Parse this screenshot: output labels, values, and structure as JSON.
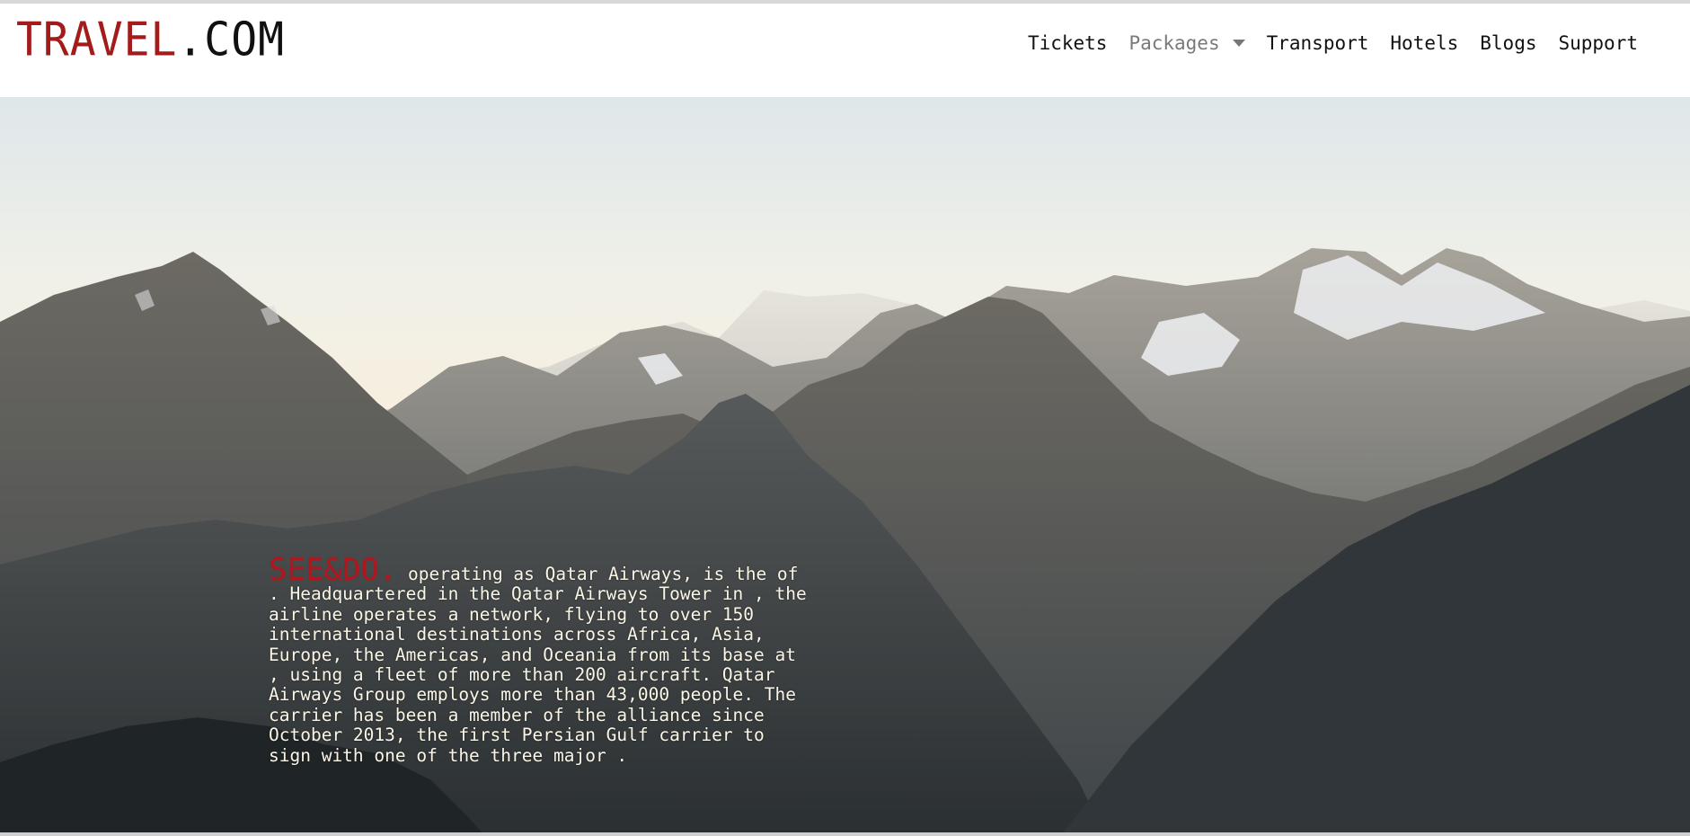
{
  "brand": {
    "name": "TRAVEL",
    "tld": ".COM",
    "accent_color": "#a31b1b"
  },
  "nav": {
    "items": [
      {
        "label": "Tickets",
        "active": false
      },
      {
        "label": "Packages",
        "dropdown": true,
        "muted": true
      },
      {
        "label": "Transport",
        "active": false
      },
      {
        "label": "Hotels",
        "active": false
      },
      {
        "label": "Blogs",
        "active": false
      },
      {
        "label": "Support",
        "active": false
      }
    ]
  },
  "hero": {
    "kicker": "SEE&DO.",
    "kicker_color": "#b3151c",
    "body": " operating as Qatar Airways, is the of . Headquartered in the Qatar Airways Tower in , the airline operates a network, flying to over 150 international destinations across Africa, Asia, Europe, the Americas, and Oceania from its base at , using a fleet of more than 200 aircraft. Qatar Airways Group employs more than 43,000 people. The carrier has been a member of the alliance since October 2013, the first Persian Gulf carrier to sign with one of the three major .",
    "background": "mountain-range-photo"
  }
}
